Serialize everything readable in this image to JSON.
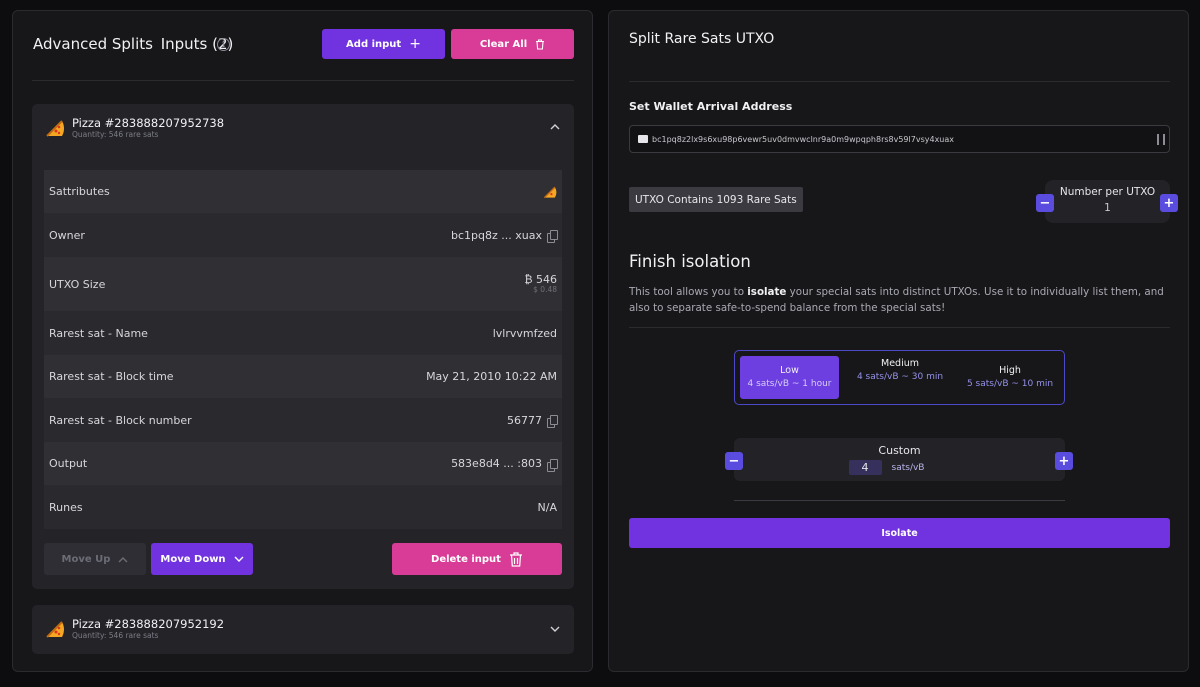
{
  "left": {
    "title": "Advanced Splits",
    "inputs_label": "Inputs (2)",
    "add_input_label": "Add input",
    "clear_all_label": "Clear All",
    "card1": {
      "title": "Pizza #283888207952738",
      "quantity": "Quantity: 546 rare sats",
      "rows": [
        {
          "label": "Sattributes",
          "value": ""
        },
        {
          "label": "Owner",
          "value": "bc1pq8z ... xuax"
        },
        {
          "label": "UTXO Size",
          "value": "546",
          "sub": "$ 0.48"
        },
        {
          "label": "Rarest sat - Name",
          "value": "lvlrvvmfzed"
        },
        {
          "label": "Rarest sat - Block time",
          "value": "May 21, 2010 10:22 AM"
        },
        {
          "label": "Rarest sat - Block number",
          "value": "56777"
        },
        {
          "label": "Output",
          "value": "583e8d4 ... :803"
        },
        {
          "label": "Runes",
          "value": "N/A"
        }
      ],
      "move_up_label": "Move Up",
      "move_down_label": "Move Down",
      "delete_label": "Delete input"
    },
    "card2": {
      "title": "Pizza #283888207952192",
      "quantity": "Quantity: 546 rare sats"
    }
  },
  "right": {
    "title": "Split Rare Sats UTXO",
    "arrival_label": "Set Wallet Arrival Address",
    "address": "bc1pq8z2lx9s6xu98p6vewr5uv0dmvwclnr9a0m9wpqph8rs8v59l7vsy4xuax",
    "utxo_contains": "UTXO Contains 1093 Rare Sats",
    "npu_label": "Number per UTXO",
    "npu_value": "1",
    "finish_heading": "Finish isolation",
    "desc_pre": "This tool allows you to ",
    "desc_bold": "isolate",
    "desc_post": " your special sats into distinct UTXOs. Use it to individually list them, and also to separate safe-to-spend balance from the special sats!",
    "fees": [
      {
        "name": "Low",
        "desc": "4 sats/vB ~ 1 hour"
      },
      {
        "name": "Medium",
        "desc": "4 sats/vB ~ 30 min"
      },
      {
        "name": "High",
        "desc": "5 sats/vB ~ 10 min"
      }
    ],
    "custom_label": "Custom",
    "custom_value": "4",
    "custom_unit": "sats/vB",
    "isolate_label": "Isolate"
  },
  "colors": {
    "purple": "#7133e0",
    "pink": "#d93c96",
    "selected_fee": "#6d3fe0",
    "stepper_blue": "#5b4ce0"
  }
}
